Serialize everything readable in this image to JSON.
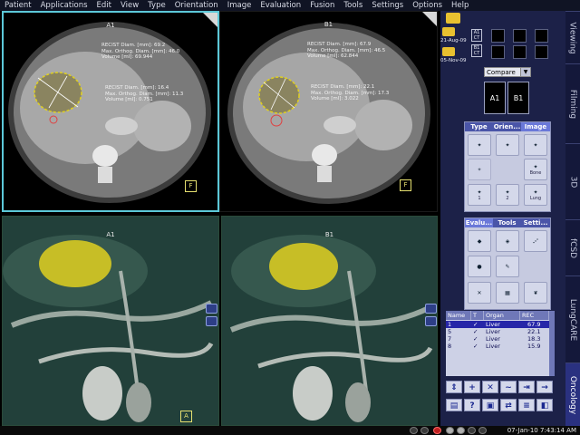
{
  "menu": [
    "Patient",
    "Applications",
    "Edit",
    "View",
    "Type",
    "Orientation",
    "Image",
    "Evaluation",
    "Fusion",
    "Tools",
    "Settings",
    "Options",
    "Help"
  ],
  "viewports": {
    "a1": {
      "label": "A1",
      "m1": [
        "RECIST Diam. [mm]: 69.2",
        "Max. Orthog. Diam. [mm]: 46.0",
        "Volume [ml]: 69.944"
      ],
      "m2": [
        "RECIST Diam. [mm]: 16.4",
        "Max. Orthog. Diam. [mm]: 11.3",
        "Volume [ml]: 0.751"
      ],
      "corner": "F"
    },
    "b1": {
      "label": "B1",
      "m1": [
        "RECIST Diam. [mm]: 67.9",
        "Max. Orthog. Diam. [mm]: 46.5",
        "Volume [ml]: 62.844"
      ],
      "m2": [
        "RECIST Diam. [mm]: 22.1",
        "Max. Orthog. Diam. [mm]: 17.3",
        "Volume [ml]: 3.022"
      ],
      "corner": "F"
    },
    "vr_a1": {
      "label": "A1",
      "corner": "A"
    },
    "vr_b1": {
      "label": "B1"
    }
  },
  "panel": {
    "studies": [
      {
        "date": "21-Aug-09",
        "tag": "A1",
        "tag2": "CT"
      },
      {
        "date": "05-Nov-09",
        "tag": "B1",
        "tag2": "CT"
      }
    ],
    "compare_mode": "Compare",
    "layout_buttons": [
      "A1",
      "B1"
    ],
    "tool_tabs": {
      "type": "Type",
      "orientation": "Orien...",
      "image": "Image"
    },
    "window_labels": [
      "Bone",
      "Lung"
    ],
    "window_numbers": [
      "1",
      "2",
      "3"
    ],
    "eval_tabs": {
      "evaluation": "Evalu...",
      "tools": "Tools",
      "settings": "Setti..."
    },
    "findings": {
      "headers": [
        "Name",
        "T",
        "Organ",
        "REC"
      ],
      "rows": [
        {
          "name": "1",
          "t": "✓",
          "organ": "Liver",
          "rec": "67.9",
          "selected": true
        },
        {
          "name": "5",
          "t": "✓",
          "organ": "Liver",
          "rec": "22.1",
          "selected": false
        },
        {
          "name": "7",
          "t": "✓",
          "organ": "Liver",
          "rec": "18.3",
          "selected": false
        },
        {
          "name": "8",
          "t": "✓",
          "organ": "Liver",
          "rec": "15.9",
          "selected": false
        }
      ]
    }
  },
  "tabs": [
    "Viewing",
    "Filming",
    "3D",
    "fCSD",
    "LungCARE",
    "Oncology"
  ],
  "active_tab": "Oncology",
  "clock": "07-Jan-10  7:43:14 AM",
  "colors": {
    "accent": "#5cc8d8",
    "panel": "#1c2148",
    "tumor": "#e0d020",
    "selection": "#2626a8"
  }
}
